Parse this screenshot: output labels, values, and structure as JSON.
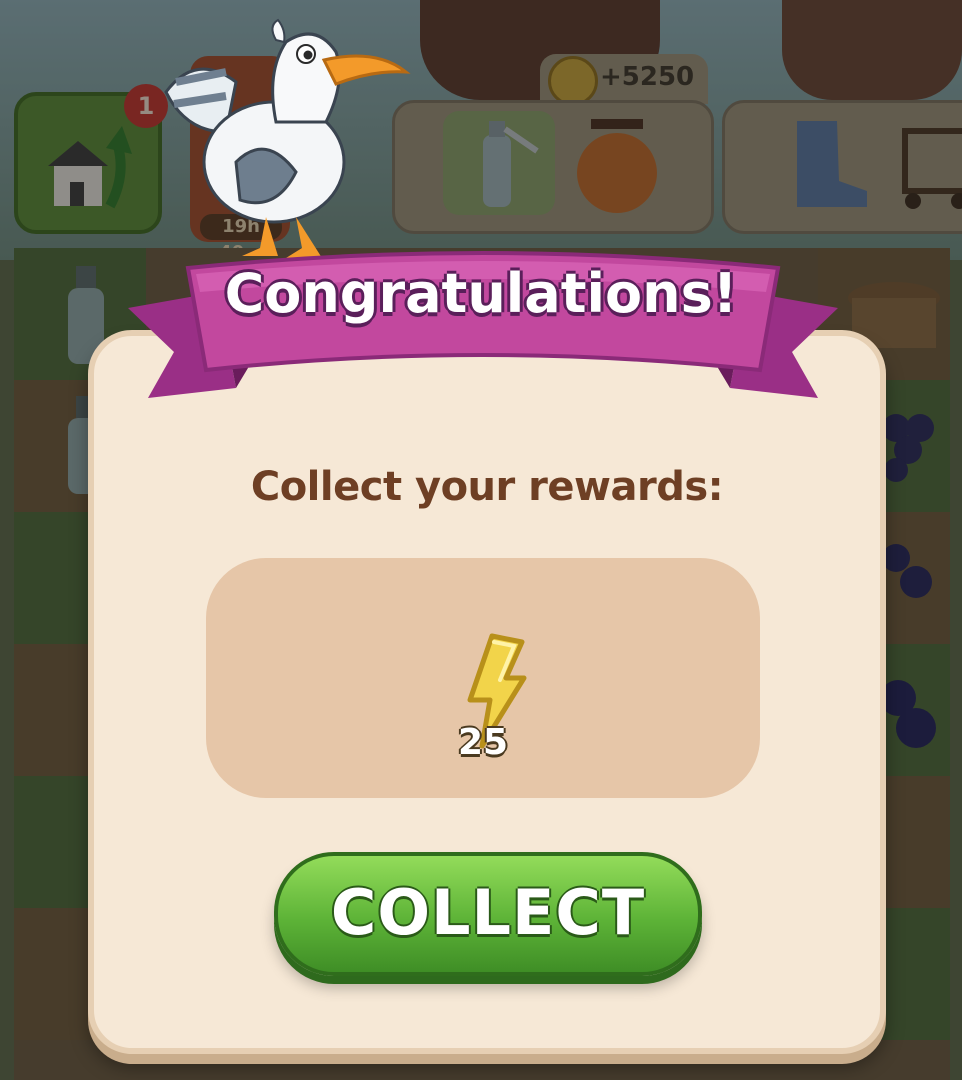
{
  "hud": {
    "home_badge_count": "1",
    "timer_text": "19h 40m",
    "order_reward_amount": "+5250"
  },
  "dialog": {
    "title": "Congratulations!",
    "subtitle": "Collect your rewards:",
    "reward": {
      "icon": "lightning-energy-icon",
      "quantity": "25"
    },
    "collect_button_label": "COLLECT"
  },
  "colors": {
    "ribbon": "#b8409e",
    "dialog_background": "#f6e8d6",
    "reward_box": "#e6c6a8",
    "collect_button": "#5db337",
    "subtitle_text": "#6e3f24"
  }
}
